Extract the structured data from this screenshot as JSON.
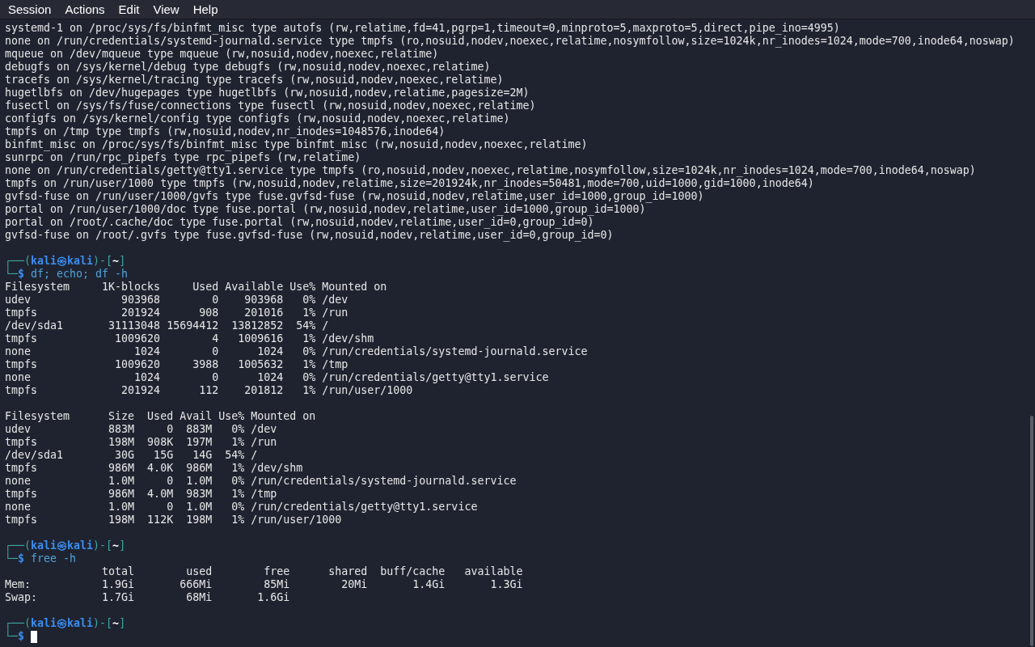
{
  "menu_bar": {
    "items": [
      "Session",
      "Actions",
      "Edit",
      "View",
      "Help"
    ]
  },
  "terminal": {
    "lines": [
      {
        "kind": "output",
        "text": "systemd-1 on /proc/sys/fs/binfmt_misc type autofs (rw,relatime,fd=41,pgrp=1,timeout=0,minproto=5,maxproto=5,direct,pipe_ino=4995)"
      },
      {
        "kind": "output",
        "text": "none on /run/credentials/systemd-journald.service type tmpfs (ro,nosuid,nodev,noexec,relatime,nosymfollow,size=1024k,nr_inodes=1024,mode=700,inode64,noswap)"
      },
      {
        "kind": "output",
        "text": "mqueue on /dev/mqueue type mqueue (rw,nosuid,nodev,noexec,relatime)"
      },
      {
        "kind": "output",
        "text": "debugfs on /sys/kernel/debug type debugfs (rw,nosuid,nodev,noexec,relatime)"
      },
      {
        "kind": "output",
        "text": "tracefs on /sys/kernel/tracing type tracefs (rw,nosuid,nodev,noexec,relatime)"
      },
      {
        "kind": "output",
        "text": "hugetlbfs on /dev/hugepages type hugetlbfs (rw,nosuid,nodev,relatime,pagesize=2M)"
      },
      {
        "kind": "output",
        "text": "fusectl on /sys/fs/fuse/connections type fusectl (rw,nosuid,nodev,noexec,relatime)"
      },
      {
        "kind": "output",
        "text": "configfs on /sys/kernel/config type configfs (rw,nosuid,nodev,noexec,relatime)"
      },
      {
        "kind": "output",
        "text": "tmpfs on /tmp type tmpfs (rw,nosuid,nodev,nr_inodes=1048576,inode64)"
      },
      {
        "kind": "output",
        "text": "binfmt_misc on /proc/sys/fs/binfmt_misc type binfmt_misc (rw,nosuid,nodev,noexec,relatime)"
      },
      {
        "kind": "output",
        "text": "sunrpc on /run/rpc_pipefs type rpc_pipefs (rw,relatime)"
      },
      {
        "kind": "output",
        "text": "none on /run/credentials/getty@tty1.service type tmpfs (ro,nosuid,nodev,noexec,relatime,nosymfollow,size=1024k,nr_inodes=1024,mode=700,inode64,noswap)"
      },
      {
        "kind": "output",
        "text": "tmpfs on /run/user/1000 type tmpfs (rw,nosuid,nodev,relatime,size=201924k,nr_inodes=50481,mode=700,uid=1000,gid=1000,inode64)"
      },
      {
        "kind": "output",
        "text": "gvfsd-fuse on /run/user/1000/gvfs type fuse.gvfsd-fuse (rw,nosuid,nodev,relatime,user_id=1000,group_id=1000)"
      },
      {
        "kind": "output",
        "text": "portal on /run/user/1000/doc type fuse.portal (rw,nosuid,nodev,relatime,user_id=1000,group_id=1000)"
      },
      {
        "kind": "output",
        "text": "portal on /root/.cache/doc type fuse.portal (rw,nosuid,nodev,relatime,user_id=0,group_id=0)"
      },
      {
        "kind": "output",
        "text": "gvfsd-fuse on /root/.gvfs type fuse.gvfsd-fuse (rw,nosuid,nodev,relatime,user_id=0,group_id=0)"
      },
      {
        "kind": "blank"
      },
      {
        "kind": "prompt",
        "open": "┌──(",
        "user": "kali㉿kali",
        "mid": ")-[",
        "dir": "~",
        "close": "]",
        "corner": "└─",
        "sign": "$",
        "command": "df; echo; df -h",
        "cursor": false
      },
      {
        "kind": "output",
        "text": "Filesystem     1K-blocks     Used Available Use% Mounted on"
      },
      {
        "kind": "output",
        "text": "udev              903968        0    903968   0% /dev"
      },
      {
        "kind": "output",
        "text": "tmpfs             201924      908    201016   1% /run"
      },
      {
        "kind": "output",
        "text": "/dev/sda1       31113048 15694412  13812852  54% /"
      },
      {
        "kind": "output",
        "text": "tmpfs            1009620        4   1009616   1% /dev/shm"
      },
      {
        "kind": "output",
        "text": "none                1024        0      1024   0% /run/credentials/systemd-journald.service"
      },
      {
        "kind": "output",
        "text": "tmpfs            1009620     3988   1005632   1% /tmp"
      },
      {
        "kind": "output",
        "text": "none                1024        0      1024   0% /run/credentials/getty@tty1.service"
      },
      {
        "kind": "output",
        "text": "tmpfs             201924      112    201812   1% /run/user/1000"
      },
      {
        "kind": "blank"
      },
      {
        "kind": "output",
        "text": "Filesystem      Size  Used Avail Use% Mounted on"
      },
      {
        "kind": "output",
        "text": "udev            883M     0  883M   0% /dev"
      },
      {
        "kind": "output",
        "text": "tmpfs           198M  908K  197M   1% /run"
      },
      {
        "kind": "output",
        "text": "/dev/sda1        30G   15G   14G  54% /"
      },
      {
        "kind": "output",
        "text": "tmpfs           986M  4.0K  986M   1% /dev/shm"
      },
      {
        "kind": "output",
        "text": "none            1.0M     0  1.0M   0% /run/credentials/systemd-journald.service"
      },
      {
        "kind": "output",
        "text": "tmpfs           986M  4.0M  983M   1% /tmp"
      },
      {
        "kind": "output",
        "text": "none            1.0M     0  1.0M   0% /run/credentials/getty@tty1.service"
      },
      {
        "kind": "output",
        "text": "tmpfs           198M  112K  198M   1% /run/user/1000"
      },
      {
        "kind": "blank"
      },
      {
        "kind": "prompt",
        "open": "┌──(",
        "user": "kali㉿kali",
        "mid": ")-[",
        "dir": "~",
        "close": "]",
        "corner": "└─",
        "sign": "$",
        "command": "free -h",
        "cursor": false
      },
      {
        "kind": "output",
        "text": "               total        used        free      shared  buff/cache   available"
      },
      {
        "kind": "output",
        "text": "Mem:           1.9Gi       666Mi        85Mi        20Mi       1.4Gi       1.3Gi"
      },
      {
        "kind": "output",
        "text": "Swap:          1.7Gi        68Mi       1.6Gi"
      },
      {
        "kind": "blank"
      },
      {
        "kind": "prompt",
        "open": "┌──(",
        "user": "kali㉿kali",
        "mid": ")-[",
        "dir": "~",
        "close": "]",
        "corner": "└─",
        "sign": "$",
        "cursor": true
      }
    ]
  }
}
